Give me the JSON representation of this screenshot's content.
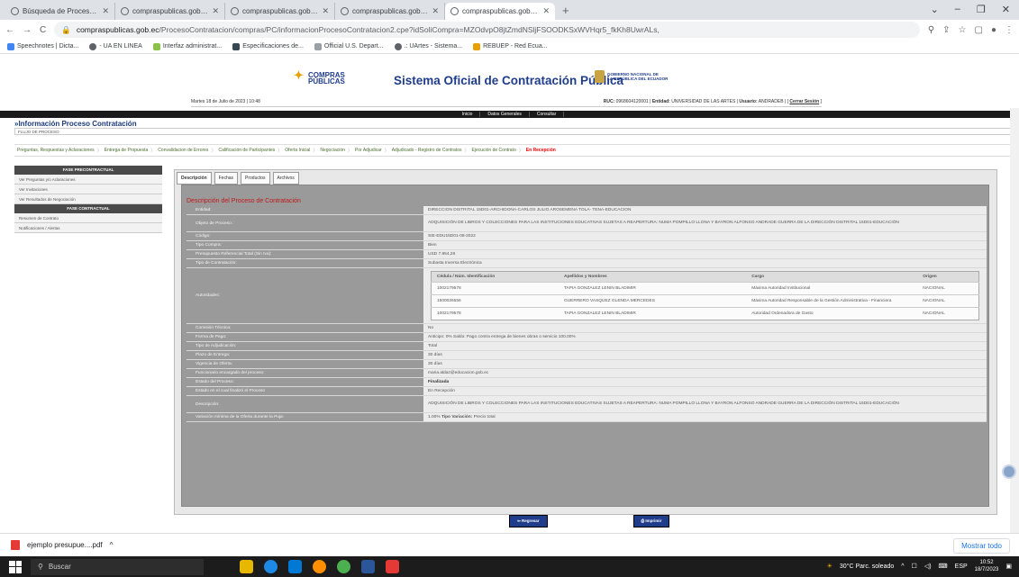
{
  "browser": {
    "tabs": [
      {
        "label": "Búsqueda de Procesos de Contrat"
      },
      {
        "label": "compraspublicas.gob.ec/Proces"
      },
      {
        "label": "compraspublicas.gob.ec/Proces"
      },
      {
        "label": "compraspublicas.gob.ec/Proces"
      },
      {
        "label": "compraspublicas.gob.ec/Proces"
      }
    ],
    "new_tab": "+",
    "url_host": "compraspublicas.gob.ec",
    "url_path": "/ProcesoContratacion/compras/PC/informacionProcesoContratacion2.cpe?idSoliCompra=MZOdvpO8jtZmdNSljFSOODKSxWVHqr5_fkKh8UwrALs,",
    "bookmarks": [
      {
        "label": "Speechnotes | Dicta...",
        "color": "#4285f4"
      },
      {
        "label": "- UA EN LINEA",
        "color": "#5f6368"
      },
      {
        "label": "Interfaz administrat...",
        "color": "#8bc34a"
      },
      {
        "label": "Especificaciones de...",
        "color": "#37474f"
      },
      {
        "label": "Official U.S. Depart...",
        "color": "#5f6368"
      },
      {
        "label": ".: UArtes - Sistema...",
        "color": "#5f6368"
      },
      {
        "label": "REBUEP - Red Ecua...",
        "color": "#e8a000"
      }
    ]
  },
  "header": {
    "logo_line1": "COMPRAS",
    "logo_line2": "PÚBLICAS",
    "title": "Sistema Oficial de Contratación Pública",
    "gov_line1": "GOBIERNO NACIONAL DE",
    "gov_line2": "LA REPÚBLICA DEL ECUADOR",
    "date": "Martes 18 de Julio de 2023 | 10:48",
    "ruc_label": "RUC:",
    "ruc": "0968604120001",
    "entidad_label": "Entidad:",
    "entidad": "UNIVERSIDAD DE LAS ARTES",
    "usuario_label": "Usuario:",
    "usuario": "ANDRADEB",
    "logout": "Cerrar Sesión"
  },
  "menu": {
    "items": [
      "Inicio",
      "Datos Generales",
      "Consultar"
    ]
  },
  "section_title": "»Información Proceso Contratación",
  "flujo_label": "FLUJO DE PROCESO",
  "steps": [
    "Preguntas, Respuestas y Aclaraciones",
    "Entrega de Propuesta",
    "Convalidacion de Errores",
    "Calificación de Participantes",
    "Oferta Inicial",
    "Negociación",
    "Por Adjudicar",
    "Adjudicado - Registro de Contratos",
    "Ejecución de Contrato",
    "En Recepción"
  ],
  "sidebar": {
    "header1": "FASE PRECONTRACTUAL",
    "pre_items": [
      "Ver Preguntas y/o Aclaraciones",
      "Ver Invitaciones",
      "Ver Resultados de Negociación"
    ],
    "header2": "FASE CONTRACTUAL",
    "con_items": [
      "Resumen de Contrato",
      "Notificaciones / Alertas"
    ]
  },
  "tabs": [
    "Descripción",
    "Fechas",
    "Productos",
    "Archivos"
  ],
  "panel_title": "Descripción del Proceso de Contratación",
  "fields": {
    "entidad": {
      "label": "Entidad:",
      "value": "DIRECCION DISTRITAL 15D01-ARCHIDONA-CARLOS JULIO AROSEMENA TOLA- TENA-EDUCACION"
    },
    "objeto": {
      "label": "Objeto de Proceso :",
      "value": "ADQUISICIÓN DE LIBROS Y COLECCIONES PARA LAS INSTITUCIONES EDUCATIVAS SUJETAS A REAPERTURA: NUMA POMPILLO LLONA Y BAYRON ALFONSO ANDRADE GUERRA DE LA DIRECCIÓN DISTRITAL 15D01-EDUCACIÓN"
    },
    "codigo": {
      "label": "Código:",
      "value": "SIE-EDU15D01-08-2022"
    },
    "tipo_compra": {
      "label": "Tipo Compra:",
      "value": "Bien"
    },
    "presupuesto": {
      "label": "Presupuesto Referencial Total (Sin Iva):",
      "value": "USD 7.954,28"
    },
    "tipo_contratacion": {
      "label": "Tipo de Contratación:",
      "value": "Subasta Inversa Electrónica"
    },
    "autoridades": {
      "label": "Autoridades:"
    },
    "comision": {
      "label": "Comisión Técnica:",
      "value": "No"
    },
    "forma_pago": {
      "label": "Forma de Pago:",
      "value": "Anticipo: 0% Saldo: Pago contra entrega de bienes obras o servicio 100.00%"
    },
    "tipo_adj": {
      "label": "Tipo de Adjudicación:",
      "value": "Total"
    },
    "plazo": {
      "label": "Plazo de Entrega:",
      "value": "30 días"
    },
    "vigencia": {
      "label": "Vigencia de Oferta:",
      "value": "30 días"
    },
    "funcionario": {
      "label": "Funcionario encargado del proceso:",
      "value": "maria.aldaz@educacion.gob.ec"
    },
    "estado": {
      "label": "Estado del Proceso:",
      "value": "Finalizada"
    },
    "estado_fin": {
      "label": "Estado en el cual finalizó el Proceso",
      "value": "En Recepción"
    },
    "descripcion": {
      "label": "Descripción:",
      "value": "ADQUISICIÓN DE LIBROS Y COLECCIONES PARA LAS INSTITUCIONES EDUCATIVAS SUJETAS A REAPERTURA: NUMA POMPILLO LLONA Y BAYRON ALFONSO ANDRADE GUERRA DE LA DIRECCIÓN DISTRITAL 15D01-EDUCACIÓN"
    },
    "variacion": {
      "label": "Variación mínima de la Oferta durante la Puja:",
      "value": "1.00%",
      "tipo_label": "Tipo Variación:",
      "tipo_value": "Precio total"
    }
  },
  "authorities": {
    "headers": [
      "Cédula / Núm. Identificación",
      "Apellidos y Nombres",
      "Cargo",
      "Origen"
    ],
    "rows": [
      [
        "1002179578",
        "TAPIA GONZALEZ LENIN BLADIMIR",
        "Máxima Autoridad Institucional",
        "NACIONAL"
      ],
      [
        "1500026556",
        "GUERRERO VASQUEZ GLENDA MERCEDES",
        "Máxima Autoridad Responsable de la Gestión Administrativa - Financiera",
        "NACIONAL"
      ],
      [
        "1002179578",
        "TAPIA GONZALEZ LENIN BLADIMIR",
        "Autoridad Ordenadora de Gasto",
        "NACIONAL"
      ]
    ]
  },
  "buttons": {
    "back": "Regresar",
    "print": "Imprimir"
  },
  "download": {
    "file": "ejemplo presupue....pdf",
    "show_all": "Mostrar todo"
  },
  "taskbar": {
    "search": "Buscar",
    "weather": "30°C Parc. soleado",
    "lang": "ESP",
    "time": "10:52",
    "date": "18/7/2023"
  }
}
